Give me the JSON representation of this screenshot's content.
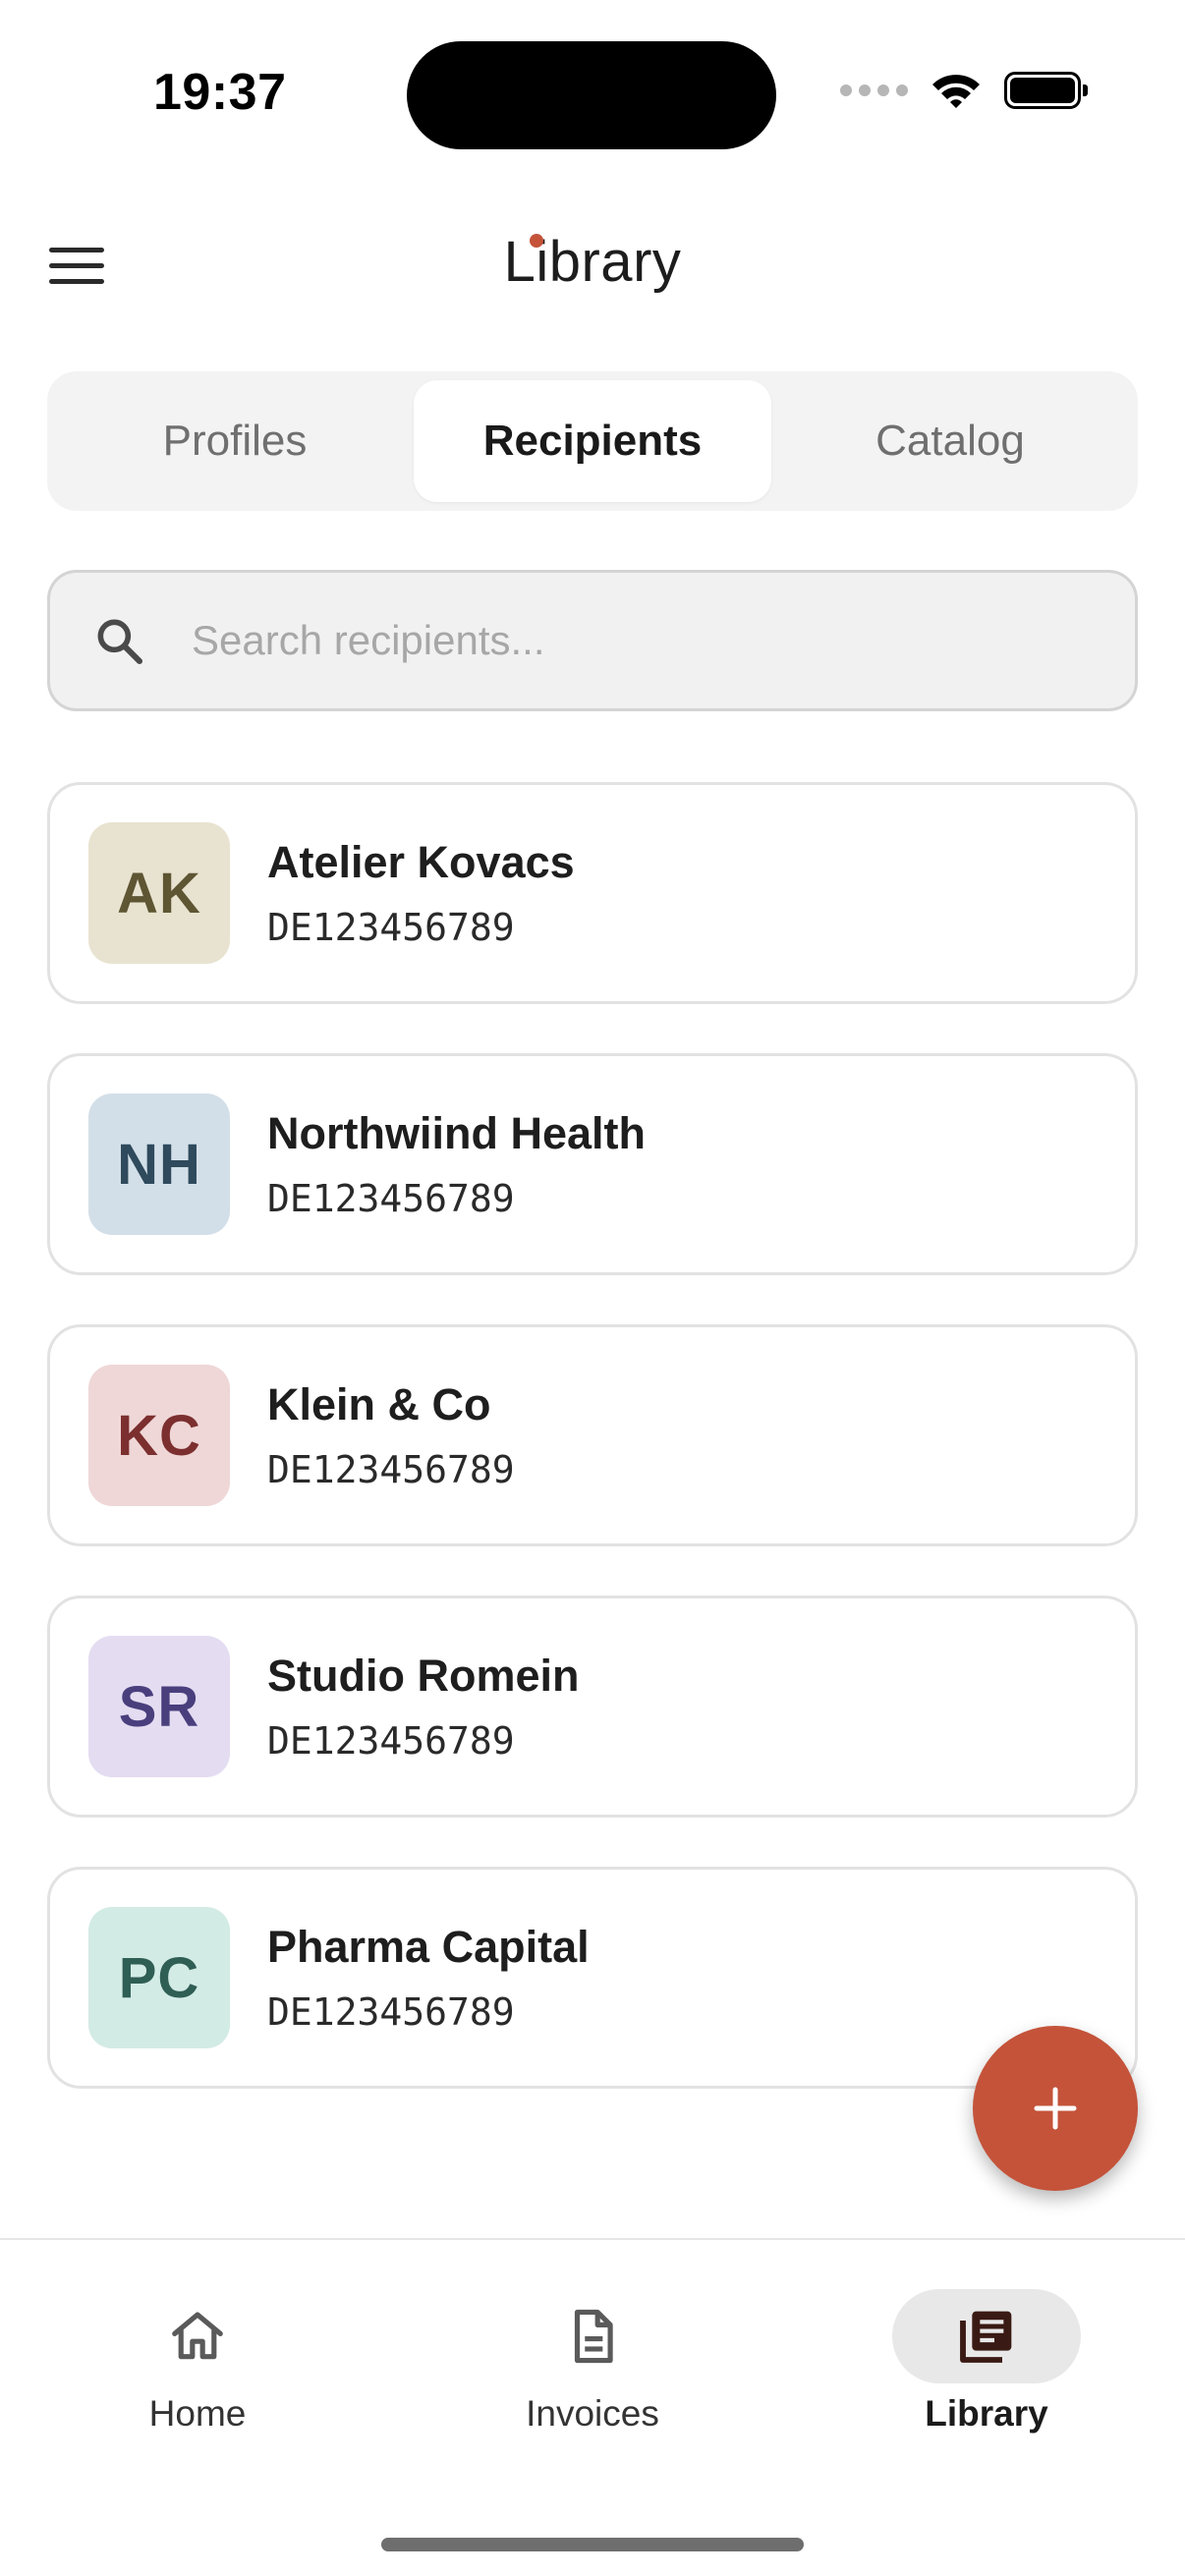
{
  "status_bar": {
    "time": "19:37"
  },
  "app_bar": {
    "title": "Library"
  },
  "tabs": [
    {
      "label": "Profiles",
      "active": false
    },
    {
      "label": "Recipients",
      "active": true
    },
    {
      "label": "Catalog",
      "active": false
    }
  ],
  "search": {
    "placeholder": "Search recipients...",
    "value": ""
  },
  "recipients": [
    {
      "initials": "AK",
      "name": "Atelier Kovacs",
      "vat": "DE123456789",
      "avatar_bg": "#e8e3d0",
      "avatar_fg": "#5e5533"
    },
    {
      "initials": "NH",
      "name": "Northwiind Health",
      "vat": "DE123456789",
      "avatar_bg": "#d3dfe8",
      "avatar_fg": "#2f4a5c"
    },
    {
      "initials": "KC",
      "name": "Klein & Co",
      "vat": "DE123456789",
      "avatar_bg": "#efd7d7",
      "avatar_fg": "#7c2f2f"
    },
    {
      "initials": "SR",
      "name": "Studio Romein",
      "vat": "DE123456789",
      "avatar_bg": "#e4dcf1",
      "avatar_fg": "#4a3f7d"
    },
    {
      "initials": "PC",
      "name": "Pharma Capital",
      "vat": "DE123456789",
      "avatar_bg": "#d3ebe5",
      "avatar_fg": "#2f5e55"
    }
  ],
  "fab": {
    "icon": "plus-icon",
    "color": "#c4533a"
  },
  "bottom_nav": [
    {
      "label": "Home",
      "icon": "home-icon",
      "active": false
    },
    {
      "label": "Invoices",
      "icon": "document-icon",
      "active": false
    },
    {
      "label": "Library",
      "icon": "library-icon",
      "active": true
    }
  ]
}
